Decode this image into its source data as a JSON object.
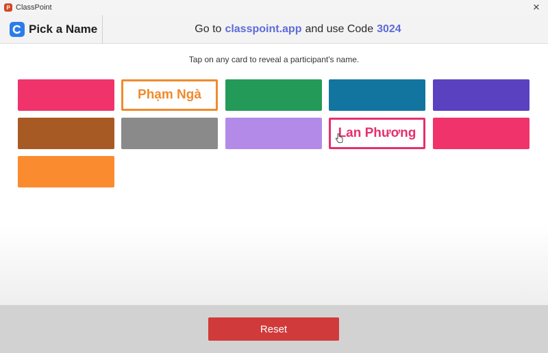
{
  "window": {
    "title": "ClassPoint",
    "icon": "powerpoint-icon"
  },
  "header": {
    "brand_title": "Pick a Name",
    "logo_icon": "classpoint-logo-icon",
    "code_prefix": "Go to",
    "site": "classpoint.app",
    "code_middle": "and use Code",
    "code": "3024",
    "accent_color": "#5c6bd8"
  },
  "instruction": "Tap on any card to reveal a participant's name.",
  "cards": [
    {
      "color": "#f0336b",
      "revealed": false,
      "name": ""
    },
    {
      "color": "#f08a2c",
      "revealed": true,
      "name": "Phạm Ngà"
    },
    {
      "color": "#239a57",
      "revealed": false,
      "name": ""
    },
    {
      "color": "#1175a0",
      "revealed": false,
      "name": ""
    },
    {
      "color": "#5a41c0",
      "revealed": false,
      "name": ""
    },
    {
      "color": "#a85a24",
      "revealed": false,
      "name": ""
    },
    {
      "color": "#8a8a8a",
      "revealed": false,
      "name": ""
    },
    {
      "color": "#b38ae8",
      "revealed": false,
      "name": ""
    },
    {
      "color": "#e62f6b",
      "revealed": true,
      "name": "Lan Phương"
    },
    {
      "color": "#f0336b",
      "revealed": false,
      "name": ""
    },
    {
      "color": "#fb8b2f",
      "revealed": false,
      "name": ""
    }
  ],
  "reset_label": "Reset",
  "reset_color": "#d13a3a"
}
